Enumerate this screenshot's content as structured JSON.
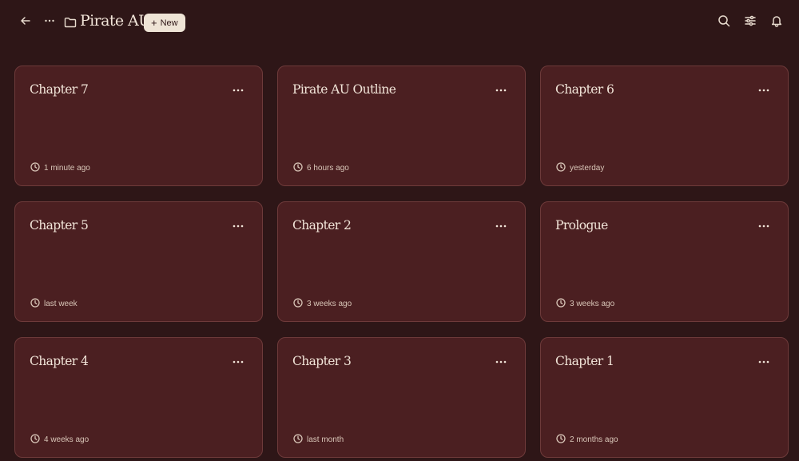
{
  "header": {
    "title": "Pirate AU",
    "new_label": "New",
    "icons": [
      "arrow-left-icon",
      "more-horizontal-icon",
      "folder-icon",
      "plus-icon",
      "search-icon",
      "sliders-icon",
      "bell-icon"
    ]
  },
  "cards": [
    {
      "title": "Chapter 7",
      "time": "1 minute ago"
    },
    {
      "title": "Pirate AU Outline",
      "time": "6 hours ago"
    },
    {
      "title": "Chapter 6",
      "time": "yesterday"
    },
    {
      "title": "Chapter 5",
      "time": "last week"
    },
    {
      "title": "Chapter 2",
      "time": "3 weeks ago"
    },
    {
      "title": "Prologue",
      "time": "3 weeks ago"
    },
    {
      "title": "Chapter 4",
      "time": "4 weeks ago"
    },
    {
      "title": "Chapter 3",
      "time": "last month"
    },
    {
      "title": "Chapter 1",
      "time": "2 months ago"
    }
  ],
  "colors": {
    "background": "#2e1617",
    "card": "#4b1f21",
    "card_border": "#6e3a3a",
    "text": "#f1e4d8",
    "button": "#efe4d6"
  }
}
